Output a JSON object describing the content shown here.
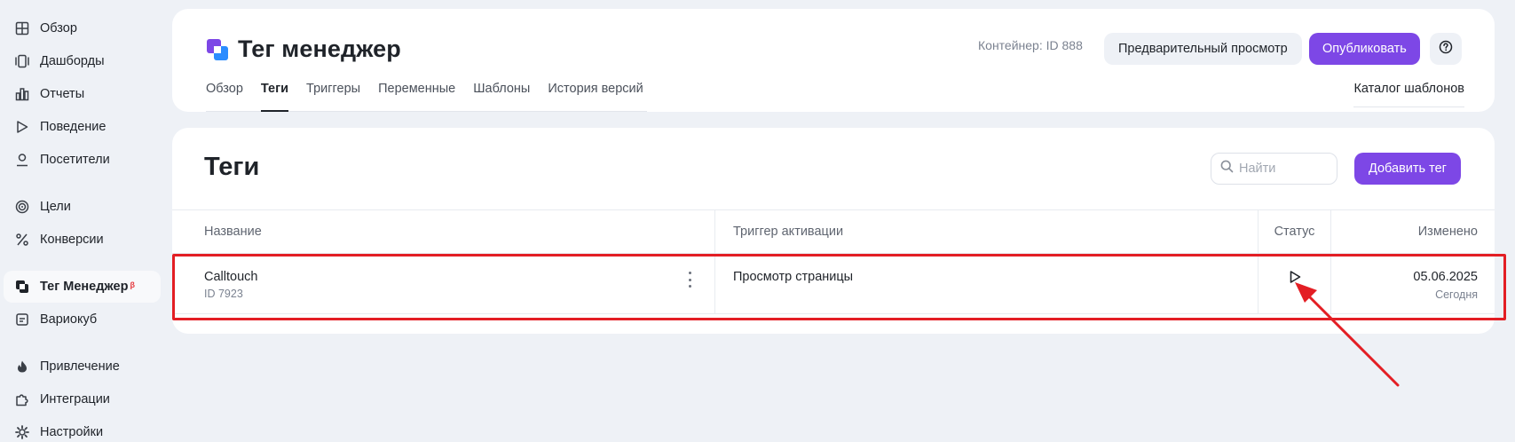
{
  "sidebar": {
    "items": [
      {
        "label": "Обзор",
        "icon": "grid-icon"
      },
      {
        "label": "Дашборды",
        "icon": "dashboards-icon"
      },
      {
        "label": "Отчеты",
        "icon": "bar-chart-icon"
      },
      {
        "label": "Поведение",
        "icon": "play-icon"
      },
      {
        "label": "Посетители",
        "icon": "user-icon"
      },
      {
        "label": "Цели",
        "icon": "target-icon"
      },
      {
        "label": "Конверсии",
        "icon": "percent-icon"
      },
      {
        "label": "Тег Менеджер",
        "icon": "tag-manager-icon",
        "badge": "β",
        "active": true
      },
      {
        "label": "Вариокуб",
        "icon": "variocube-icon"
      },
      {
        "label": "Привлечение",
        "icon": "flame-icon"
      },
      {
        "label": "Интеграции",
        "icon": "puzzle-icon"
      },
      {
        "label": "Настройки",
        "icon": "gear-icon"
      }
    ]
  },
  "header": {
    "title": "Тег менеджер",
    "container": "Контейнер: ID 888",
    "preview_label": "Предварительный просмотр",
    "publish_label": "Опубликовать",
    "help_icon": "question-circle-icon",
    "tabs": [
      {
        "label": "Обзор"
      },
      {
        "label": "Теги",
        "active": true
      },
      {
        "label": "Триггеры"
      },
      {
        "label": "Переменные"
      },
      {
        "label": "Шаблоны"
      },
      {
        "label": "История версий"
      }
    ],
    "catalog_label": "Каталог шаблонов"
  },
  "main": {
    "title": "Теги",
    "search_placeholder": "Найти",
    "add_label": "Добавить тег",
    "columns": [
      "Название",
      "Триггер активации",
      "Статус",
      "Изменено"
    ],
    "rows": [
      {
        "name": "Calltouch",
        "id": "ID 7923",
        "trigger": "Просмотр страницы",
        "status": "play-icon",
        "date": "05.06.2025",
        "date_sub": "Сегодня"
      }
    ]
  },
  "colors": {
    "accent": "#7d47e6",
    "annotation": "#e31e24",
    "background": "#eef1f6"
  }
}
